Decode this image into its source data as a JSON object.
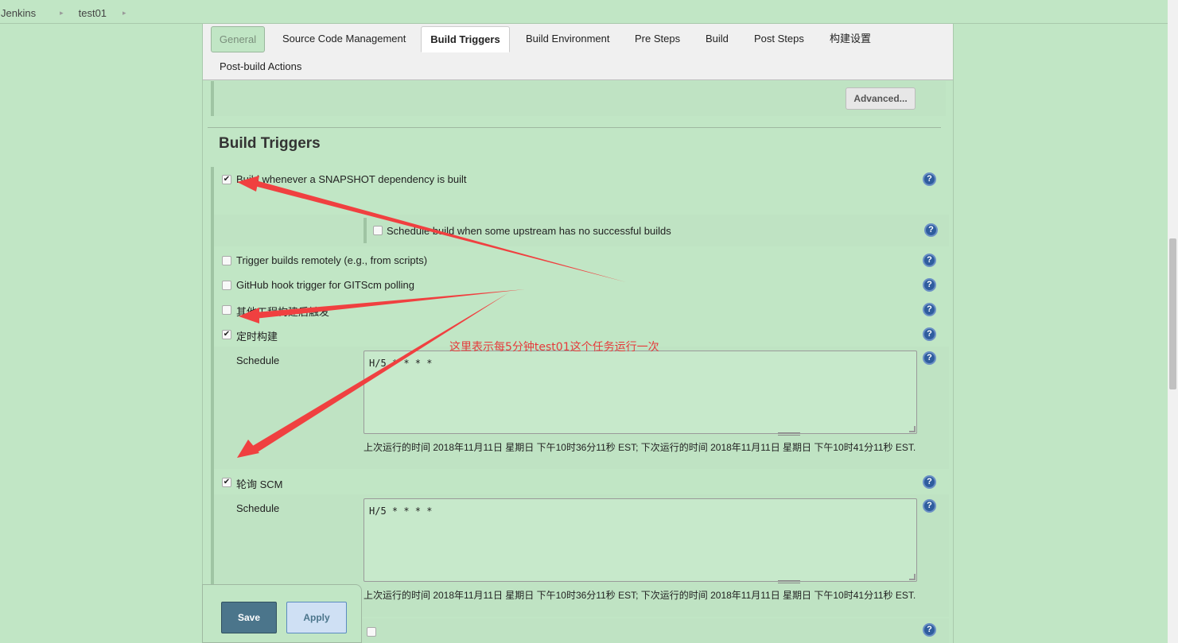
{
  "breadcrumb": {
    "home": "Jenkins",
    "job": "test01"
  },
  "tabs": {
    "general": "General",
    "scm": "Source Code Management",
    "build_triggers": "Build Triggers",
    "build_env": "Build Environment",
    "pre_steps": "Pre Steps",
    "build": "Build",
    "post_steps": "Post Steps",
    "build_settings": "构建设置",
    "post_build": "Post-build Actions"
  },
  "advanced_label": "Advanced...",
  "section_title": "Build Triggers",
  "options": {
    "snapshot": {
      "label": "Build whenever a SNAPSHOT dependency is built",
      "checked": true
    },
    "upstream": {
      "label": "Schedule build when some upstream has no successful builds",
      "checked": false
    },
    "remote": {
      "label": "Trigger builds remotely (e.g., from scripts)",
      "checked": false
    },
    "github": {
      "label": "GitHub hook trigger for GITScm polling",
      "checked": false
    },
    "other_project": {
      "label": "其他工程构建后触发",
      "checked": false
    },
    "timer": {
      "label": "定时构建",
      "checked": true
    },
    "poll_scm": {
      "label": "轮询 SCM",
      "checked": true
    }
  },
  "timer_schedule": {
    "label": "Schedule",
    "value": "H/5  * * * *",
    "note": "上次运行的时间 2018年11月11日 星期日 下午10时36分11秒 EST; 下次运行的时间 2018年11月11日 星期日 下午10时41分11秒 EST."
  },
  "scm_schedule": {
    "label": "Schedule",
    "value": "H/5 * * * *",
    "note": "上次运行的时间 2018年11月11日 星期日 下午10时36分11秒 EST; 下次运行的时间 2018年11月11日 星期日 下午10时41分11秒 EST."
  },
  "annotation": "这里表示每5分钟test01这个任务运行一次",
  "buttons": {
    "save": "Save",
    "apply": "Apply"
  },
  "icons": {
    "help": "help-icon",
    "checkbox": "checkbox-icon",
    "breadcrumb_sep": "chevron-right-icon"
  },
  "colors": {
    "background": "#c1e6c5",
    "annotation": "#e53b3b",
    "save": "#4b758b",
    "help": "#2f5d9e"
  }
}
